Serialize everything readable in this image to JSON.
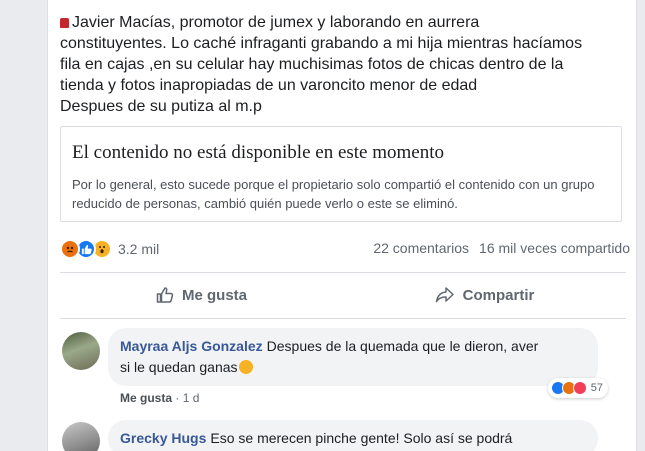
{
  "post": {
    "lines": [
      "Javier Macías, promotor de jumex y laborando en aurrera",
      "constituyentes. Lo caché infraganti grabando a mi hija mientras hacíamos",
      "fila en cajas ,en su celular hay muchisimas fotos de chicas dentro de la",
      "tienda y fotos inapropiadas de un varoncito menor de edad",
      "Despues de su putiza al m.p"
    ]
  },
  "unavailable": {
    "title": "El contenido no está disponible en este momento",
    "body": "Por lo general, esto sucede porque el propietario solo compartió el contenido con un grupo reducido de personas, cambió quién puede verlo o este se eliminó."
  },
  "stats": {
    "reactions": [
      "angry-icon",
      "like-icon",
      "wow-icon"
    ],
    "reaction_count": "3.2 mil",
    "comments": "22 comentarios",
    "shares": "16 mil veces compartido"
  },
  "actions": {
    "like": "Me gusta",
    "share": "Compartir"
  },
  "comments": [
    {
      "author": "Mayraa Aljs Gonzalez",
      "text_line1": "Despues de la quemada que le dieron, aver",
      "text_line2": "si le quedan ganas",
      "reactions_count": "57",
      "like_label": "Me gusta",
      "separator": "·",
      "time": "1 d"
    },
    {
      "author": "Grecky Hugs",
      "text_line1": "Eso se merecen pinche gente! Solo así se podrá"
    }
  ],
  "colors": {
    "link_blue": "#385898",
    "like_blue": "#1877f2",
    "angry_orange": "#e9710f",
    "wow_yellow": "#f7b125",
    "love_red": "#f33e58"
  }
}
